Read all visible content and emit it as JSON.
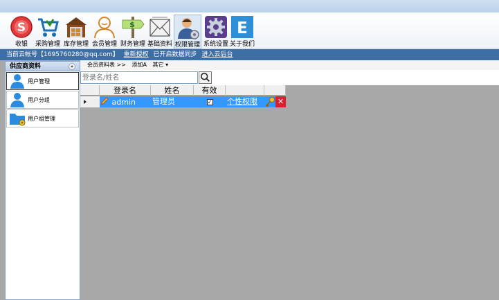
{
  "toolbar": {
    "items": [
      {
        "label": "收银",
        "icon": "cashier-icon"
      },
      {
        "label": "采购管理",
        "icon": "cart-icon"
      },
      {
        "label": "库存管理",
        "icon": "warehouse-icon"
      },
      {
        "label": "会员管理",
        "icon": "member-icon"
      },
      {
        "label": "财务管理",
        "icon": "finance-sign-icon"
      },
      {
        "label": "基础资料",
        "icon": "envelope-icon"
      },
      {
        "label": "权限管理",
        "icon": "admin-user-icon"
      },
      {
        "label": "系统设置",
        "icon": "gear-icon"
      },
      {
        "label": "关于我们",
        "icon": "about-e-icon"
      }
    ],
    "active": "权限管理"
  },
  "status": {
    "account": "当前云帐号【1695760280@qq.com】",
    "reauth": "重新授权",
    "sync": "已开启数据同步",
    "cloud": "进入云后台"
  },
  "sidebar": {
    "title": "供应商资料",
    "collapse_glyph": "»",
    "items": [
      {
        "label": "用户管理",
        "active": true
      },
      {
        "label": "用户分组",
        "active": false
      },
      {
        "label": "用户组管理",
        "active": false
      }
    ]
  },
  "nav": {
    "breadcrumb": "会员资料表 >>",
    "add": "添加A",
    "other": "其它 ▾"
  },
  "search": {
    "placeholder": "登录名/姓名"
  },
  "table": {
    "columns": [
      "登录名",
      "姓名",
      "有效"
    ],
    "rows": [
      {
        "login": "admin",
        "name": "管理员",
        "valid": "✓",
        "perm": "个性权限",
        "delete": "✕"
      }
    ]
  },
  "colors": {
    "status_bar": "#3d6ea5",
    "selection": "#3399ff",
    "workspace": "#a8a8a8"
  }
}
